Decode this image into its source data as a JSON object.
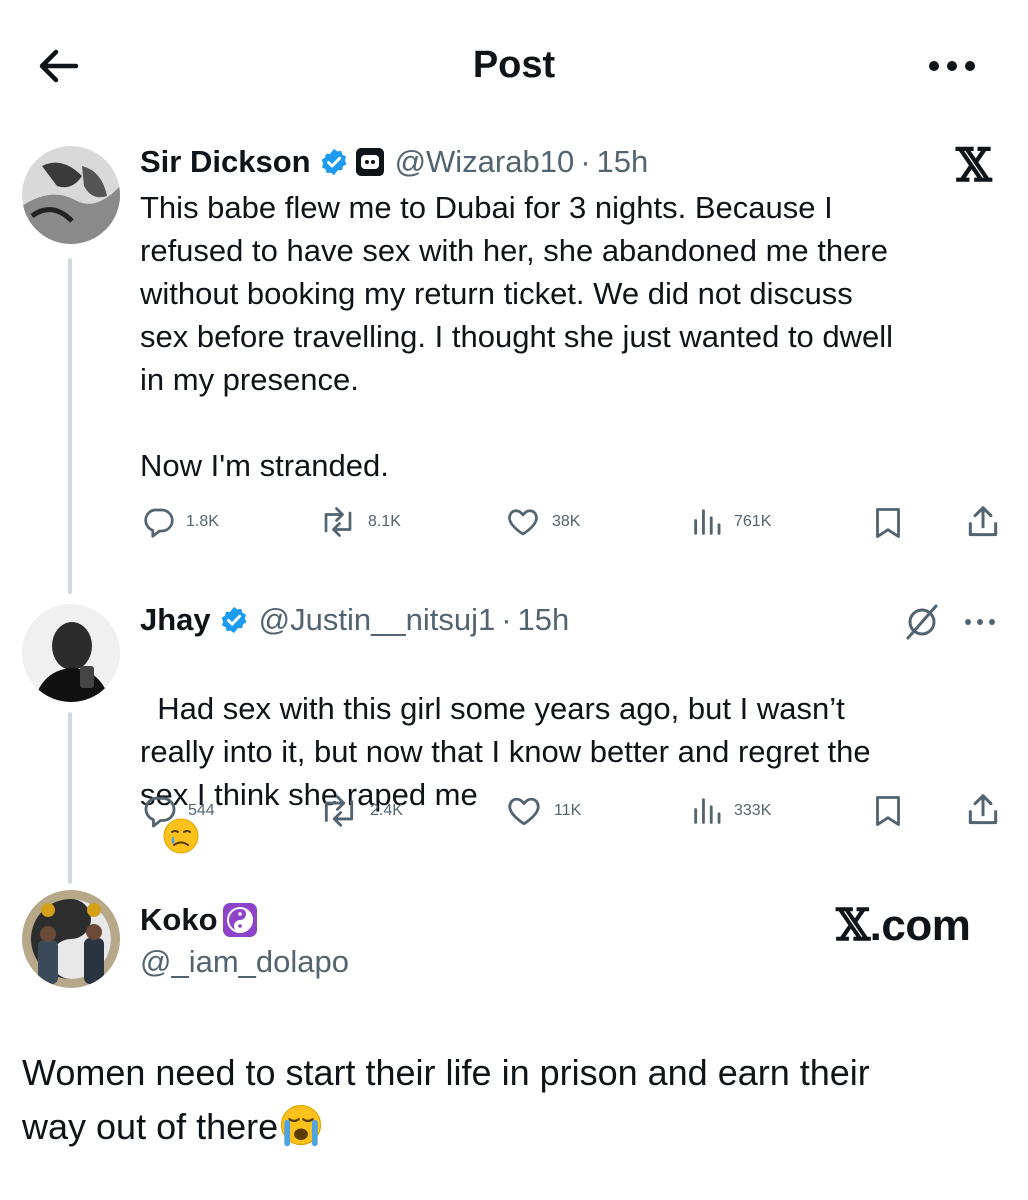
{
  "header": {
    "title": "Post"
  },
  "post1": {
    "name": "Sir Dickson",
    "handle": "@Wizarab10",
    "dot": "·",
    "time": "15h",
    "text": "This babe flew me to Dubai for 3 nights. Because I\nrefused to have sex with her, she abandoned me there\nwithout booking my return ticket. We did not discuss\nsex before travelling. I thought she just wanted to dwell\nin my presence.\n\nNow I'm stranded.",
    "stats": {
      "replies": "1.8K",
      "reposts": "8.1K",
      "likes": "38K",
      "views": "761K"
    }
  },
  "post2": {
    "name": "Jhay",
    "handle": "@Justin__nitsuj1",
    "dot": "·",
    "time": "15h",
    "text": "Had sex with this girl some years ago, but I wasn’t\nreally into it, but now that I know better and regret the\nsex I think she raped me",
    "stats": {
      "replies": "544",
      "reposts": "2.4K",
      "likes": "11K",
      "views": "333K"
    }
  },
  "post3": {
    "name": "Koko",
    "handle": "@_iam_dolapo",
    "text": "Women need to start their life in prison and earn their\nway out of there"
  },
  "watermark": {
    "x_logo": "𝕏",
    "site": "X.com"
  },
  "colors": {
    "verified": "#1d9bf0",
    "muted": "#536471",
    "thread": "#cfd9de",
    "yin_yang_bg": "#8e44c9"
  },
  "icons": [
    "back-arrow-icon",
    "more-icon",
    "verified-badge-icon",
    "bot-label-icon",
    "reply-icon",
    "repost-icon",
    "like-icon",
    "views-icon",
    "bookmark-icon",
    "share-icon",
    "grok-icon",
    "yin-yang-icon",
    "tear-face-emoji",
    "crying-face-emoji"
  ]
}
